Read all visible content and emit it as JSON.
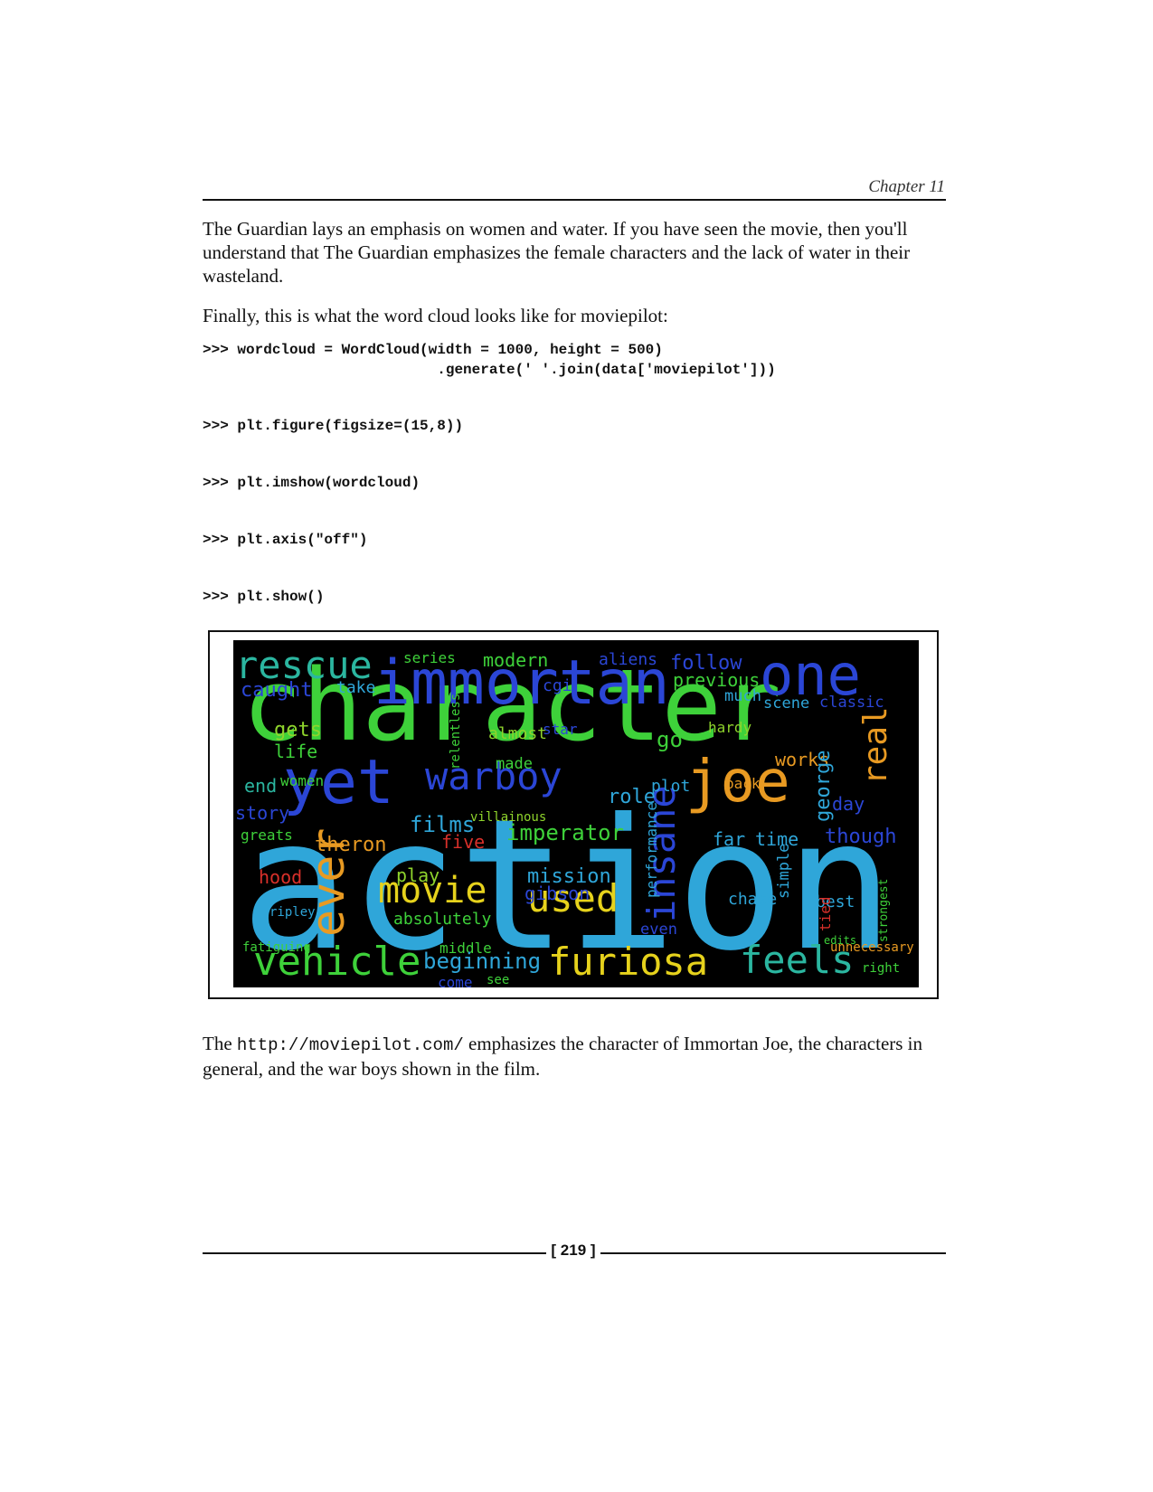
{
  "header": {
    "chapter": "Chapter 11"
  },
  "paragraphs": {
    "p1": "The Guardian lays an emphasis on women and water. If you have seen the movie, then you'll understand that The Guardian emphasizes the female characters and the lack of water in their wasteland.",
    "p2": "Finally, this is what the word cloud looks like for moviepilot:",
    "p3_before": "The ",
    "p3_link": "http://moviepilot.com/",
    "p3_after": " emphasizes the character of Immortan Joe, the characters in general, and the war boys shown in the film."
  },
  "code": {
    "line1": ">>> wordcloud = WordCloud(width = 1000, height = 500)",
    "line2": "                           .generate(' '.join(data['moviepilot']))",
    "line3": ">>> plt.figure(figsize=(15,8))",
    "line4": ">>> plt.imshow(wordcloud)",
    "line5": ">>> plt.axis(\"off\")",
    "line6": ">>> plt.show()"
  },
  "wordcloud": {
    "colors": {
      "green": "#3ed13a",
      "blue": "#2b46d6",
      "cyan": "#2fa6d9",
      "yellow": "#e6d21c",
      "orange": "#e89a22",
      "red": "#d8302a",
      "teal": "#2bb6a0",
      "lime": "#8fd42c"
    },
    "words": [
      {
        "t": "action",
        "c": "cyan",
        "vertical": false
      },
      {
        "t": "character",
        "c": "green",
        "vertical": false
      },
      {
        "t": "immortan",
        "c": "blue",
        "vertical": false
      },
      {
        "t": "one",
        "c": "blue",
        "vertical": false
      },
      {
        "t": "rescue",
        "c": "teal",
        "vertical": false
      },
      {
        "t": "yet",
        "c": "blue",
        "vertical": false
      },
      {
        "t": "joe",
        "c": "orange",
        "vertical": false
      },
      {
        "t": "warboy",
        "c": "blue",
        "vertical": false
      },
      {
        "t": "vehicle",
        "c": "green",
        "vertical": false
      },
      {
        "t": "furiosa",
        "c": "yellow",
        "vertical": false
      },
      {
        "t": "feels",
        "c": "teal",
        "vertical": false
      },
      {
        "t": "movie",
        "c": "yellow",
        "vertical": false
      },
      {
        "t": "used",
        "c": "yellow",
        "vertical": false
      },
      {
        "t": "insane",
        "c": "blue",
        "vertical": true
      },
      {
        "t": "ever",
        "c": "orange",
        "vertical": true
      },
      {
        "t": "real",
        "c": "orange",
        "vertical": true
      },
      {
        "t": "caught",
        "c": "blue",
        "vertical": false
      },
      {
        "t": "series",
        "c": "green",
        "vertical": false
      },
      {
        "t": "modern",
        "c": "green",
        "vertical": false
      },
      {
        "t": "aliens",
        "c": "blue",
        "vertical": false
      },
      {
        "t": "follow",
        "c": "blue",
        "vertical": false
      },
      {
        "t": "previous",
        "c": "green",
        "vertical": false
      },
      {
        "t": "take",
        "c": "cyan",
        "vertical": false
      },
      {
        "t": "cgi",
        "c": "blue",
        "vertical": false
      },
      {
        "t": "much",
        "c": "cyan",
        "vertical": false
      },
      {
        "t": "scene",
        "c": "cyan",
        "vertical": false
      },
      {
        "t": "classic",
        "c": "blue",
        "vertical": false
      },
      {
        "t": "gets",
        "c": "lime",
        "vertical": false
      },
      {
        "t": "life",
        "c": "green",
        "vertical": false
      },
      {
        "t": "almost",
        "c": "lime",
        "vertical": false
      },
      {
        "t": "made",
        "c": "green",
        "vertical": false
      },
      {
        "t": "star",
        "c": "blue",
        "vertical": false
      },
      {
        "t": "go",
        "c": "green",
        "vertical": false
      },
      {
        "t": "hardy",
        "c": "lime",
        "vertical": false
      },
      {
        "t": "works",
        "c": "orange",
        "vertical": false
      },
      {
        "t": "end",
        "c": "teal",
        "vertical": false
      },
      {
        "t": "women",
        "c": "green",
        "vertical": false
      },
      {
        "t": "story",
        "c": "blue",
        "vertical": false
      },
      {
        "t": "role",
        "c": "cyan",
        "vertical": false
      },
      {
        "t": "plot",
        "c": "cyan",
        "vertical": false
      },
      {
        "t": "back",
        "c": "orange",
        "vertical": false
      },
      {
        "t": "george",
        "c": "cyan",
        "vertical": true
      },
      {
        "t": "day",
        "c": "blue",
        "vertical": false
      },
      {
        "t": "though",
        "c": "blue",
        "vertical": false
      },
      {
        "t": "films",
        "c": "cyan",
        "vertical": false
      },
      {
        "t": "villainous",
        "c": "lime",
        "vertical": false
      },
      {
        "t": "imperator",
        "c": "green",
        "vertical": false
      },
      {
        "t": "theron",
        "c": "orange",
        "vertical": false
      },
      {
        "t": "five",
        "c": "red",
        "vertical": false
      },
      {
        "t": "far",
        "c": "cyan",
        "vertical": false
      },
      {
        "t": "time",
        "c": "cyan",
        "vertical": false
      },
      {
        "t": "greats",
        "c": "green",
        "vertical": false
      },
      {
        "t": "hood",
        "c": "red",
        "vertical": false
      },
      {
        "t": "play",
        "c": "lime",
        "vertical": false
      },
      {
        "t": "mission",
        "c": "cyan",
        "vertical": false
      },
      {
        "t": "gibson",
        "c": "blue",
        "vertical": false
      },
      {
        "t": "absolutely",
        "c": "green",
        "vertical": false
      },
      {
        "t": "chase",
        "c": "cyan",
        "vertical": false
      },
      {
        "t": "best",
        "c": "cyan",
        "vertical": false
      },
      {
        "t": "simple",
        "c": "cyan",
        "vertical": true
      },
      {
        "t": "performance",
        "c": "cyan",
        "vertical": true
      },
      {
        "t": "even",
        "c": "blue",
        "vertical": false
      },
      {
        "t": "middle",
        "c": "green",
        "vertical": false
      },
      {
        "t": "beginning",
        "c": "cyan",
        "vertical": false
      },
      {
        "t": "ripley",
        "c": "cyan",
        "vertical": false
      },
      {
        "t": "fatiguing",
        "c": "green",
        "vertical": false
      },
      {
        "t": "come",
        "c": "blue",
        "vertical": false
      },
      {
        "t": "see",
        "c": "green",
        "vertical": false
      },
      {
        "t": "right",
        "c": "green",
        "vertical": false
      },
      {
        "t": "unnecessary",
        "c": "orange",
        "vertical": false
      },
      {
        "t": "edits",
        "c": "green",
        "vertical": false
      },
      {
        "t": "tied",
        "c": "red",
        "vertical": true
      },
      {
        "t": "strongest",
        "c": "green",
        "vertical": true
      },
      {
        "t": "relentless",
        "c": "green",
        "vertical": true
      }
    ]
  },
  "footer": {
    "page": "[ 219 ]"
  }
}
